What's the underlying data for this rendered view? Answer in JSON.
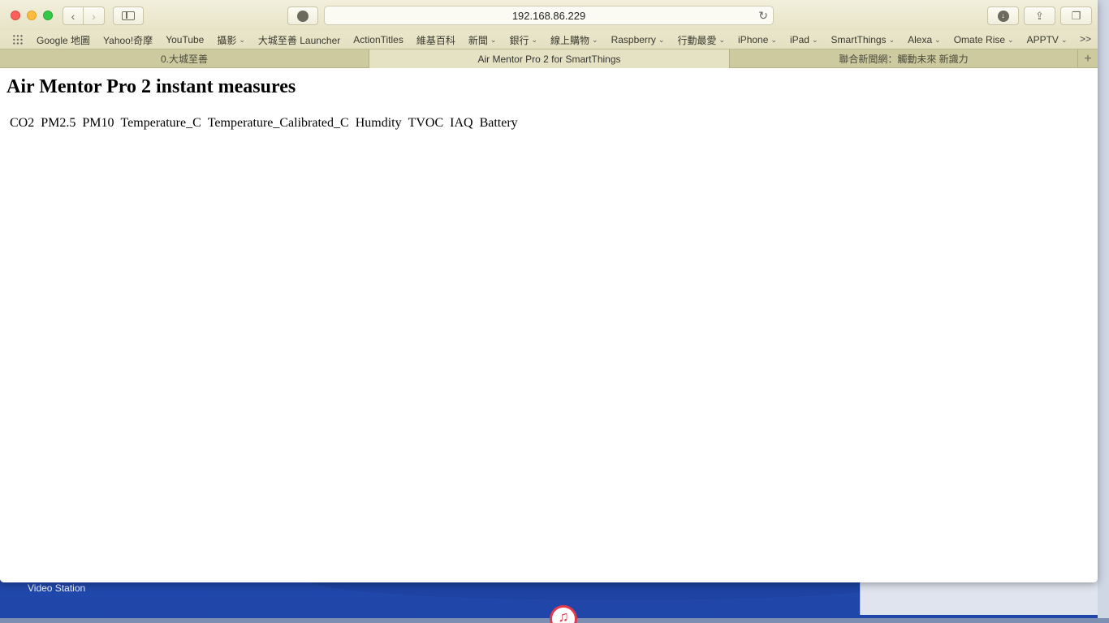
{
  "browser": {
    "url": "192.168.86.229",
    "bookmarks": [
      {
        "label": "Google 地圖",
        "dropdown": false
      },
      {
        "label": "Yahoo!奇摩",
        "dropdown": false
      },
      {
        "label": "YouTube",
        "dropdown": false
      },
      {
        "label": "攝影",
        "dropdown": true
      },
      {
        "label": "大城至善 Launcher",
        "dropdown": false
      },
      {
        "label": "ActionTitles",
        "dropdown": false
      },
      {
        "label": "維基百科",
        "dropdown": false
      },
      {
        "label": "新聞",
        "dropdown": true
      },
      {
        "label": "銀行",
        "dropdown": true
      },
      {
        "label": "線上購物",
        "dropdown": true
      },
      {
        "label": "Raspberry",
        "dropdown": true
      },
      {
        "label": "行動最愛",
        "dropdown": true
      },
      {
        "label": "iPhone",
        "dropdown": true
      },
      {
        "label": "iPad",
        "dropdown": true
      },
      {
        "label": "SmartThings",
        "dropdown": true
      },
      {
        "label": "Alexa",
        "dropdown": true
      },
      {
        "label": "Omate Rise",
        "dropdown": true
      },
      {
        "label": "APPTV",
        "dropdown": true
      }
    ],
    "bookmarks_more": ">>",
    "tabs": [
      {
        "title": "0.大城至善",
        "active": false
      },
      {
        "title": "Air Mentor Pro 2 for SmartThings",
        "active": true
      },
      {
        "title": "聯合新聞網：觸動未來 新識力",
        "active": false
      }
    ],
    "new_tab_symbol": "+"
  },
  "page": {
    "title": "Air Mentor Pro 2 instant measures",
    "measures": [
      "CO2",
      "PM2.5",
      "PM10",
      "Temperature_C",
      "Temperature_Calibrated_C",
      "Humdity",
      "TVOC",
      "IAQ",
      "Battery"
    ]
  },
  "desktop": {
    "video_station_label": "Video Station"
  }
}
